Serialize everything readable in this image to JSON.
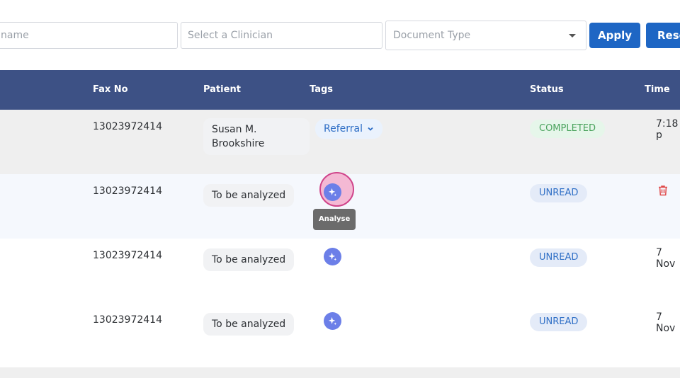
{
  "filters": {
    "name_placeholder": "name",
    "clinician_placeholder": "Select a Clinician",
    "doctype_placeholder": "Document Type",
    "apply_label": "Apply",
    "reset_label": "Rese"
  },
  "table": {
    "headers": {
      "fax": "Fax No",
      "patient": "Patient",
      "tags": "Tags",
      "status": "Status",
      "time": "Time"
    },
    "rows": [
      {
        "fax": "13023972414",
        "patient": "Susan M. Brookshire",
        "tag": "Referral",
        "status": "COMPLETED",
        "time": "7:18 p"
      },
      {
        "fax": "13023972414",
        "patient": "To be analyzed",
        "status": "UNREAD",
        "tooltip": "Analyse"
      },
      {
        "fax": "13023972414",
        "patient": "To be analyzed",
        "status": "UNREAD",
        "time": "7 Nov"
      },
      {
        "fax": "13023972414",
        "patient": "To be analyzed",
        "status": "UNREAD",
        "time": "7 Nov"
      }
    ]
  },
  "colors": {
    "header_bg": "#3d5185",
    "primary": "#1e66c4",
    "ai_icon": "#6c7fe8",
    "trash": "#e04a4a"
  }
}
